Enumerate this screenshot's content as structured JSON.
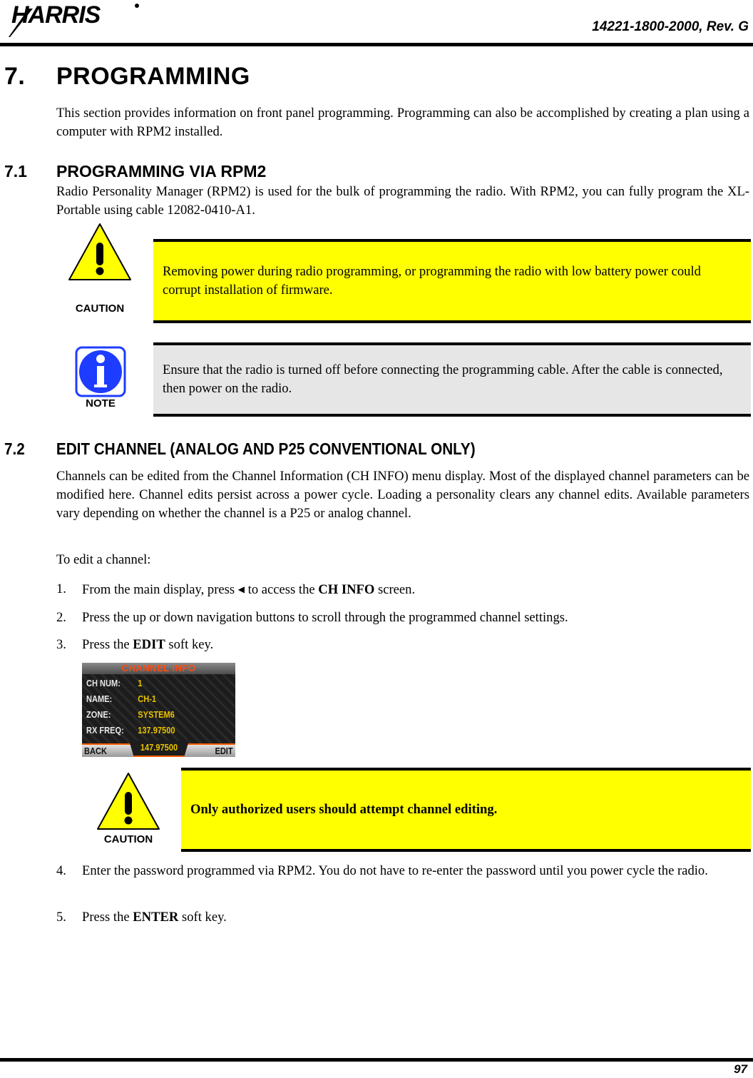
{
  "header": {
    "logo_text": "HARRIS",
    "doc_number": "14221-1800-2000, Rev. G"
  },
  "footer": {
    "page_number": "97"
  },
  "section7": {
    "number": "7.",
    "title": "PROGRAMMING",
    "intro": "This section provides information on front panel programming. Programming can also be accomplished by creating a plan using a computer with RPM2 installed."
  },
  "section7_1": {
    "number": "7.1",
    "title": "PROGRAMMING VIA RPM2",
    "body": "Radio Personality Manager (RPM2) is used for the bulk of programming the radio. With RPM2, you can fully program the XL-Portable using cable 12082-0410-A1.",
    "caution": {
      "icon_label": "CAUTION",
      "text": "Removing power during radio programming, or programming the radio with low battery power could corrupt installation of firmware."
    },
    "note": {
      "icon_label": "NOTE",
      "text": "Ensure that the radio is turned off before connecting the programming cable. After the cable is connected, then power on the radio."
    }
  },
  "section7_2": {
    "number": "7.2",
    "title": "EDIT CHANNEL (ANALOG AND P25 CONVENTIONAL ONLY)",
    "body": "Channels can be edited from the Channel Information (CH INFO) menu display. Most of the displayed channel parameters can be modified here. Channel edits persist across a power cycle. Loading a personality clears any channel edits. Available parameters vary depending on whether the channel is a P25 or analog channel.",
    "lead": "To edit a channel:",
    "steps": [
      {
        "n": "1.",
        "pre": "From the main display, press ",
        "glyph": "◀",
        "mid": " to access the ",
        "bold": "CH INFO",
        "post": " screen."
      },
      {
        "n": "2.",
        "text": "Press the up or down navigation buttons to scroll through the programmed channel settings."
      },
      {
        "n": "3.",
        "pre": "Press the ",
        "bold": "EDIT",
        "post": " soft key."
      },
      {
        "n": "4.",
        "text": "Enter the password programmed via RPM2. You do not have to re-enter the password until you power cycle the radio."
      },
      {
        "n": "5.",
        "pre": "Press the ",
        "bold": "ENTER",
        "post": " soft key."
      }
    ],
    "screen": {
      "title": "CHANNEL INFO",
      "rows": [
        {
          "label": "CH NUM:",
          "value": "1"
        },
        {
          "label": "NAME:",
          "value": "CH-1"
        },
        {
          "label": "ZONE:",
          "value": "SYSTEM6"
        },
        {
          "label": "RX FREQ:",
          "value": "137.97500"
        }
      ],
      "center_value": "147.97500",
      "softkey_left": "BACK",
      "softkey_right": "EDIT"
    },
    "caution": {
      "icon_label": "CAUTION",
      "text": "Only authorized users should attempt channel editing."
    }
  }
}
